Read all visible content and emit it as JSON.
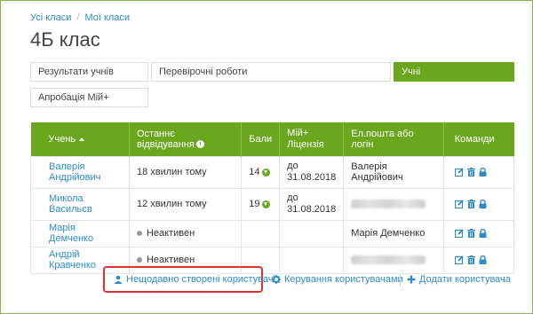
{
  "breadcrumb": {
    "all_classes": "Усі класи",
    "separator": "/",
    "my_classes": "Мої класи"
  },
  "page": {
    "title": "4Б клас"
  },
  "tabs": [
    {
      "label": "Результати учнів",
      "active": false
    },
    {
      "label": "Перевірочні роботи",
      "active": false
    },
    {
      "label": "Учні",
      "active": true
    },
    {
      "label": "Апробація Мій+",
      "active": false
    }
  ],
  "table": {
    "headers": {
      "student": "Учень",
      "last_visit": "Останнє відвідування",
      "info_icon": "i",
      "points": "Бали",
      "license_line1": "Мій+",
      "license_line2": "Ліцензія",
      "login": "Ел.пошта або логін",
      "commands": "Команди"
    },
    "rows": [
      {
        "name": "Валерія Андрійович",
        "last_visit": "18 хвилин тому",
        "inactive": false,
        "points": "14",
        "license_line1": "до",
        "license_line2": "31.08.2018",
        "login": "Валерія Андрійович",
        "login_hidden": false
      },
      {
        "name": "Микола Васильєв",
        "last_visit": "12 хвилин тому",
        "inactive": false,
        "points": "19",
        "license_line1": "до",
        "license_line2": "31.08.2018",
        "login": "",
        "login_hidden": true
      },
      {
        "name": "Марія Демченко",
        "last_visit": "Неактивен",
        "inactive": true,
        "points": "",
        "license_line1": "",
        "license_line2": "",
        "login": "Марія Демченко",
        "login_hidden": false
      },
      {
        "name": "Андрій Кравченко",
        "last_visit": "Неактивен",
        "inactive": true,
        "points": "",
        "license_line1": "",
        "license_line2": "",
        "login": "",
        "login_hidden": true
      }
    ]
  },
  "actions": {
    "recent_users": "Нещодавно створені користувачі",
    "manage_users": "Керування користувачами",
    "add_user": "Додати користувача"
  },
  "colors": {
    "accent": "#6aa61e",
    "link": "#2e8bc9",
    "highlight": "#e03030"
  }
}
